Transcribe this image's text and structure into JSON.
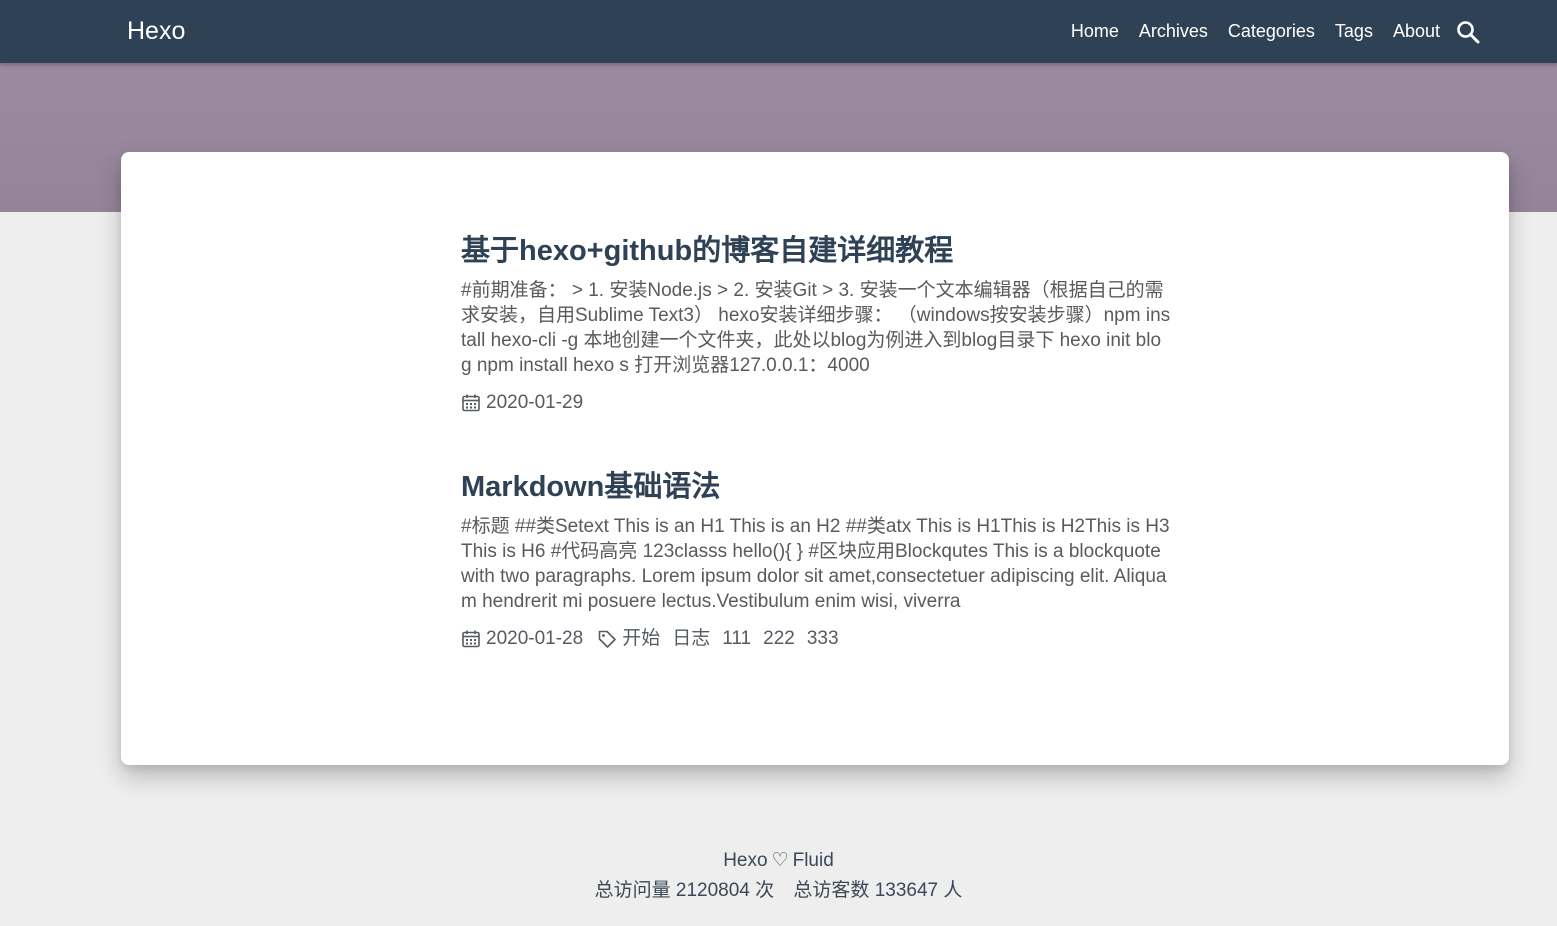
{
  "navbar": {
    "brand": "Hexo",
    "links": [
      "Home",
      "Archives",
      "Categories",
      "Tags",
      "About"
    ],
    "search_icon": "search-icon"
  },
  "banner": {
    "scroll_icon": "chevron-down-icon",
    "background_color": "#9a8ba0"
  },
  "colors": {
    "navbar_bg": "#2f4154",
    "title": "#2f4154",
    "page_bg": "#eeeeee"
  },
  "posts": [
    {
      "title": "基于hexo+github的博客自建详细教程",
      "excerpt": "#前期准备： > 1. 安装Node.js > 2. 安装Git > 3. 安装一个文本编辑器（根据自己的需求安装，自用Sublime Text3） hexo安装详细步骤： （windows按安装步骤）npm install hexo-cli -g 本地创建一个文件夹，此处以blog为例进入到blog目录下 hexo init blog npm install hexo s 打开浏览器127.0.0.1：4000",
      "date": "2020-01-29",
      "tags": []
    },
    {
      "title": "Markdown基础语法",
      "excerpt": "#标题 ##类Setext This is an H1 This is an H2 ##类atx This is H1This is H2This is H3This is H6 #代码高亮 123classs hello(){ } #区块应用Blockqutes This is a blockquote with two paragraphs. Lorem ipsum dolor sit amet,consectetuer adipiscing elit. Aliquam hendrerit mi posuere lectus.Vestibulum enim wisi, viverra",
      "date": "2020-01-28",
      "tags": [
        "开始",
        "日志",
        "111",
        "222",
        "333"
      ]
    }
  ],
  "footer": {
    "hexo": "Hexo",
    "heart": "♡",
    "fluid": "Fluid",
    "total_pv_label": "总访问量",
    "total_pv": "2120804",
    "total_pv_unit": "次",
    "total_uv_label": "总访客数",
    "total_uv": "133647",
    "total_uv_unit": "人"
  }
}
